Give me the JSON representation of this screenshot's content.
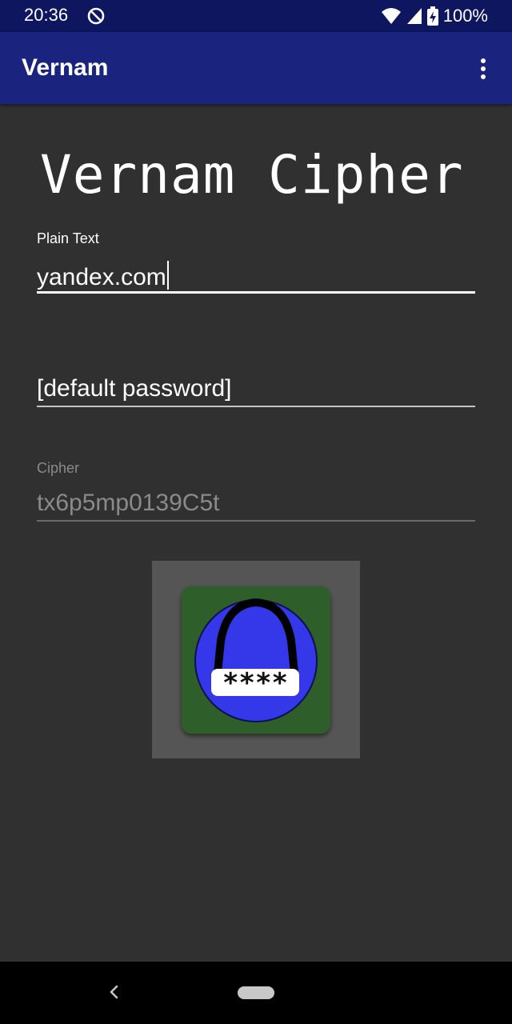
{
  "status_bar": {
    "time": "20:36",
    "battery": "100%",
    "icons": [
      "dnd-icon",
      "wifi-icon",
      "signal-icon",
      "battery-icon"
    ]
  },
  "app_bar": {
    "title": "Vernam",
    "menu_icon": "overflow-menu-icon"
  },
  "main": {
    "heading": "Vernam Cipher",
    "plain_text": {
      "label": "Plain Text",
      "value": "yandex.com"
    },
    "password": {
      "value": "[default password]"
    },
    "cipher": {
      "label": "Cipher",
      "value": "tx6p5mp0139C5t"
    },
    "logo": {
      "icon": "lock-password-icon",
      "text": "****"
    }
  },
  "nav_bar": {
    "icons": [
      "back-icon",
      "home-icon"
    ]
  },
  "colors": {
    "app_bar": "#1a237e",
    "status_bar": "#0f1660",
    "background": "#303030",
    "logo_bg": "#2e5e2a",
    "logo_circle": "#3538e8",
    "disabled_text": "#8a8a8a"
  }
}
